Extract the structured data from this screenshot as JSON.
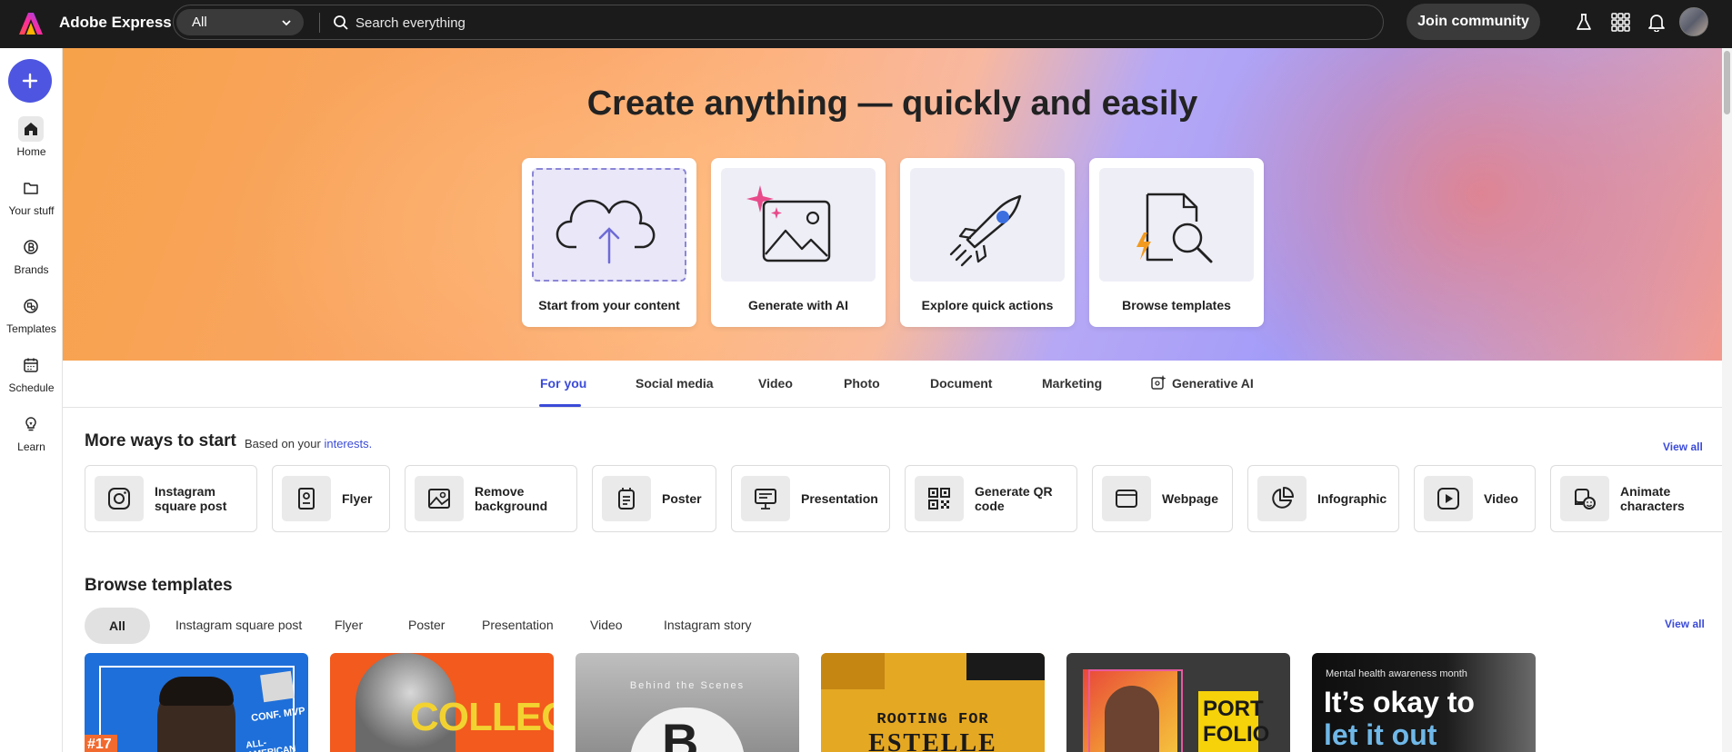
{
  "app": {
    "title": "Adobe Express",
    "brand_color": "#fa0f00"
  },
  "search": {
    "scope": "All",
    "placeholder": "Search everything"
  },
  "topbar": {
    "join_label": "Join community",
    "icons": [
      "flask-icon",
      "apps-grid-icon",
      "bell-icon",
      "avatar"
    ]
  },
  "sidebar": {
    "create_icon": "plus-icon",
    "items": [
      {
        "label": "Home",
        "icon": "home-icon"
      },
      {
        "label": "Your stuff",
        "icon": "folder-icon"
      },
      {
        "label": "Brands",
        "icon": "brand-icon"
      },
      {
        "label": "Templates",
        "icon": "templates-icon"
      },
      {
        "label": "Schedule",
        "icon": "calendar-icon"
      },
      {
        "label": "Learn",
        "icon": "lightbulb-icon"
      }
    ]
  },
  "hero": {
    "title": "Create anything — quickly and easily",
    "cards": [
      {
        "label": "Start from your content",
        "icon": "cloud-upload-icon"
      },
      {
        "label": "Generate with AI",
        "icon": "ai-image-icon"
      },
      {
        "label": "Explore quick actions",
        "icon": "rocket-icon"
      },
      {
        "label": "Browse templates",
        "icon": "template-search-icon"
      }
    ]
  },
  "tabs": {
    "items": [
      "For you",
      "Social media",
      "Video",
      "Photo",
      "Document",
      "Marketing",
      "Generative AI"
    ],
    "active": "For you"
  },
  "more_ways": {
    "title": "More ways to start",
    "sub_prefix": "Based on your",
    "sub_link": "interests.",
    "view_all": "View all",
    "items": [
      {
        "label": "Instagram square post",
        "icon": "instagram-icon"
      },
      {
        "label": "Flyer",
        "icon": "flyer-icon"
      },
      {
        "label": "Remove background",
        "icon": "remove-background-icon"
      },
      {
        "label": "Poster",
        "icon": "poster-icon"
      },
      {
        "label": "Presentation",
        "icon": "presentation-icon"
      },
      {
        "label": "Generate QR code",
        "icon": "qr-code-icon"
      },
      {
        "label": "Webpage",
        "icon": "webpage-icon"
      },
      {
        "label": "Infographic",
        "icon": "infographic-icon"
      },
      {
        "label": "Video",
        "icon": "video-icon"
      },
      {
        "label": "Animate characters",
        "icon": "animate-characters-icon"
      }
    ]
  },
  "browse": {
    "title": "Browse templates",
    "view_all": "View all",
    "filters": [
      "All",
      "Instagram square post",
      "Flyer",
      "Poster",
      "Presentation",
      "Video",
      "Instagram story"
    ],
    "active_filter": "All",
    "templates": [
      {
        "text": "CONF. MVP",
        "text2": "ALL-AMERICAN",
        "text3": "#17"
      },
      {
        "text": "COLLEGE"
      },
      {
        "text": "Behind the Scenes",
        "text2": "B"
      },
      {
        "text": "ROOTING FOR",
        "text2": "ESTELLE"
      },
      {
        "text": "PORT",
        "text2": "FOLIO"
      },
      {
        "text": "Mental health awareness month",
        "text2": "It’s okay to",
        "text3": "let it out"
      }
    ]
  }
}
